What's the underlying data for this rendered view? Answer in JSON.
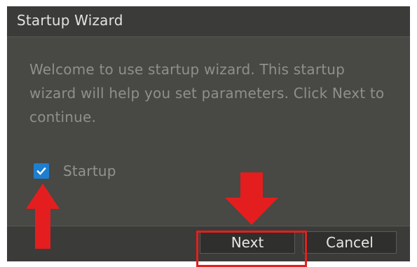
{
  "dialog": {
    "title": "Startup Wizard",
    "message": "Welcome to use startup wizard. This startup wizard will help you set parameters. Click Next to continue.",
    "checkbox": {
      "label": "Startup",
      "checked": true
    },
    "buttons": {
      "next_label": "Next",
      "cancel_label": "Cancel"
    }
  },
  "colors": {
    "dialog_background": "#484845",
    "titlebar_background": "#3b3b39",
    "checkbox_accent": "#1e7fd0",
    "annotation_red": "#e41e1e"
  },
  "icons": {
    "checkbox_mark": "check-icon",
    "down_arrow": "red-down-arrow",
    "up_arrow": "red-up-arrow"
  }
}
